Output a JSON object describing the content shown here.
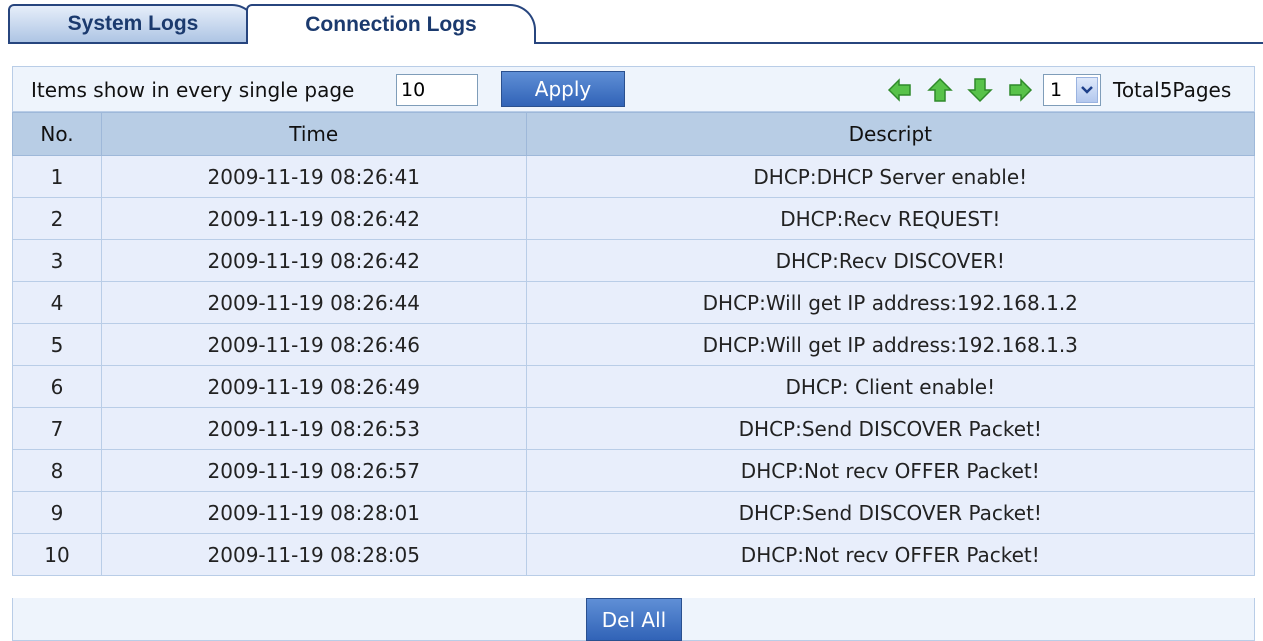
{
  "tabs": [
    {
      "label": "System Logs"
    },
    {
      "label": "Connection Logs"
    }
  ],
  "toolbar": {
    "items_label": "Items show in every single page",
    "items_value": "10",
    "apply_label": "Apply",
    "page_value": "1",
    "total_label": "Total5Pages"
  },
  "icons": {
    "prev": "arrow-left-icon",
    "first": "arrow-up-icon",
    "last": "arrow-down-icon",
    "next": "arrow-right-icon",
    "accent": "#3fae3f"
  },
  "table": {
    "headers": [
      "No.",
      "Time",
      "Descript"
    ],
    "rows": [
      {
        "no": "1",
        "time": "2009-11-19 08:26:41",
        "desc": "DHCP:DHCP Server enable!"
      },
      {
        "no": "2",
        "time": "2009-11-19 08:26:42",
        "desc": "DHCP:Recv REQUEST!"
      },
      {
        "no": "3",
        "time": "2009-11-19 08:26:42",
        "desc": "DHCP:Recv DISCOVER!"
      },
      {
        "no": "4",
        "time": "2009-11-19 08:26:44",
        "desc": "DHCP:Will get IP address:192.168.1.2"
      },
      {
        "no": "5",
        "time": "2009-11-19 08:26:46",
        "desc": "DHCP:Will get IP address:192.168.1.3"
      },
      {
        "no": "6",
        "time": "2009-11-19 08:26:49",
        "desc": "DHCP: Client enable!"
      },
      {
        "no": "7",
        "time": "2009-11-19 08:26:53",
        "desc": "DHCP:Send DISCOVER Packet!"
      },
      {
        "no": "8",
        "time": "2009-11-19 08:26:57",
        "desc": "DHCP:Not recv OFFER Packet!"
      },
      {
        "no": "9",
        "time": "2009-11-19 08:28:01",
        "desc": "DHCP:Send DISCOVER Packet!"
      },
      {
        "no": "10",
        "time": "2009-11-19 08:28:05",
        "desc": "DHCP:Not recv OFFER Packet!"
      }
    ]
  },
  "footer": {
    "del_all_label": "Del All"
  }
}
